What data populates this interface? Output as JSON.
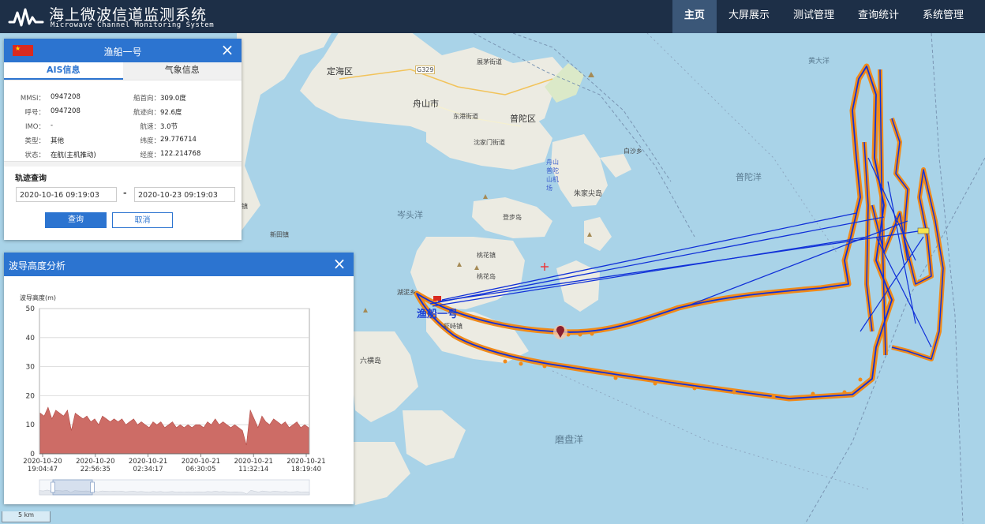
{
  "header": {
    "title": "海上微波信道监测系统",
    "subtitle": "Microwave Channel Monitoring System",
    "nav": [
      "主页",
      "大屏展示",
      "测试管理",
      "查询统计",
      "系统管理"
    ],
    "active_nav": 0
  },
  "map_labels": {
    "dinghai": "定海区",
    "zhoushan": "舟山市",
    "road": "G329",
    "putuo": "普陀区",
    "dongjie": "东港街道",
    "shenjia": "沈家门街道",
    "zhanmao": "展茅街道",
    "baisha": "白沙乡",
    "airport": "舟山普陀山机场",
    "zhujianjian": "朱家尖岛",
    "putuoyang": "普陀洋",
    "huangdayang": "黄大洋",
    "cetouyang": "岑头洋",
    "dengbu": "登步岛",
    "taohua": "桃花镇",
    "taohuadao": "桃花岛",
    "xiaqi": "虾峙镇",
    "liuheng": "六横岛",
    "mopanyang": "磨盘洋",
    "hudao": "湖泥乡",
    "xiaoqu": "新田镇",
    "ship_label": "渔船一号",
    "side_label": "镇",
    "scale": "5 km"
  },
  "ais_panel": {
    "title": "渔船一号",
    "tabs": [
      "AIS信息",
      "气象信息"
    ],
    "fields_left": [
      {
        "label": "MMSI：",
        "value": "0947208"
      },
      {
        "label": "呼号：",
        "value": "0947208"
      },
      {
        "label": "IMO：",
        "value": "-"
      },
      {
        "label": "类型：",
        "value": "其他"
      },
      {
        "label": "状态：",
        "value": "在航(主机推动)"
      }
    ],
    "fields_right": [
      {
        "label": "船首向：",
        "value": "309.0度"
      },
      {
        "label": "航迹向：",
        "value": "92.6度"
      },
      {
        "label": "航速：",
        "value": "3.0节"
      },
      {
        "label": "纬度：",
        "value": "29.776714"
      },
      {
        "label": "经度：",
        "value": "122.214768"
      }
    ],
    "track_title": "轨迹查询",
    "start_date": "2020-10-16 09:19:03",
    "dash": "-",
    "end_date": "2020-10-23 09:19:03",
    "query_btn": "查询",
    "cancel_btn": "取消"
  },
  "wave_panel": {
    "title": "波导高度分析",
    "ylabel": "波导高度(m)"
  },
  "colors": {
    "header_bg": "#1d2f47",
    "panel_head": "#2c74d0",
    "track_orange": "#f08a1a",
    "track_blue": "#1030d8",
    "chart_fill": "#cd6c66"
  },
  "chart_data": {
    "type": "area",
    "title": "波导高度分析",
    "xlabel": "",
    "ylabel": "波导高度(m)",
    "ylim": [
      0,
      50
    ],
    "yticks": [
      0,
      10,
      20,
      30,
      40,
      50
    ],
    "xticks": [
      [
        "2020-10-20",
        "19:04:47"
      ],
      [
        "2020-10-20",
        "22:56:35"
      ],
      [
        "2020-10-21",
        "02:34:17"
      ],
      [
        "2020-10-21",
        "06:30:05"
      ],
      [
        "2020-10-21",
        "11:32:14"
      ],
      [
        "2020-10-21",
        "18:19:40"
      ]
    ],
    "series": [
      {
        "values": [
          14,
          13,
          16,
          12,
          15,
          14,
          13,
          15,
          8,
          14,
          13,
          12,
          13,
          11,
          12,
          10,
          13,
          12,
          11,
          12,
          11,
          12,
          10,
          11,
          12,
          10,
          11,
          10,
          9,
          11,
          10,
          11,
          9,
          10,
          11,
          9,
          10,
          9,
          10,
          9,
          10,
          10,
          9,
          11,
          10,
          12,
          10,
          11,
          10,
          9,
          10,
          9,
          8,
          3,
          15,
          12,
          9,
          13,
          11,
          10,
          12,
          11,
          10,
          11,
          9,
          10,
          11,
          9,
          10,
          9
        ]
      }
    ],
    "grid": true
  }
}
